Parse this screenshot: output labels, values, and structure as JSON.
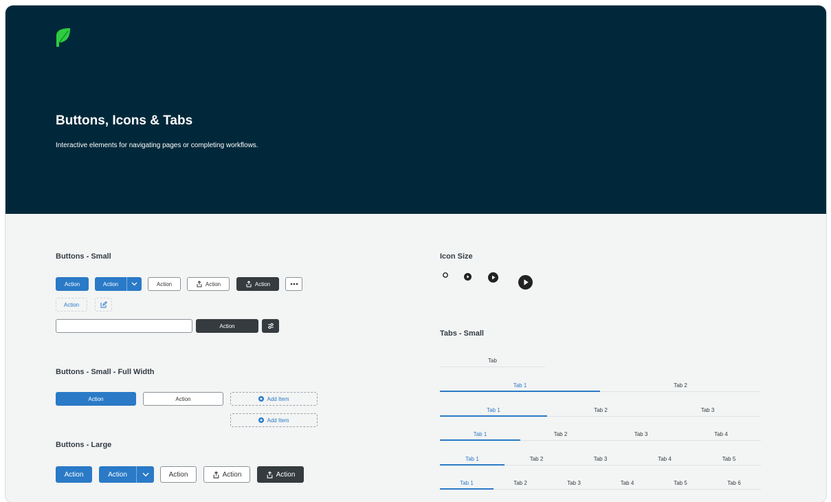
{
  "hero": {
    "title": "Buttons, Icons & Tabs",
    "subtitle": "Interactive elements for navigating pages or completing workflows."
  },
  "buttons_small": {
    "title": "Buttons - Small",
    "primary": "Action",
    "split": "Action",
    "outline": "Action",
    "outline_icon": "Action",
    "dark_icon": "Action",
    "ghost": "Action",
    "input_button": "Action"
  },
  "buttons_full": {
    "title": "Buttons - Small - Full Width",
    "primary": "Action",
    "outline": "Action",
    "add_item_1": "Add Item",
    "add_item_2": "Add Item"
  },
  "buttons_large": {
    "title": "Buttons - Large",
    "primary": "Action",
    "split": "Action",
    "outline": "Action",
    "outline_icon": "Action",
    "dark_icon": "Action"
  },
  "icon_size": {
    "title": "Icon Size"
  },
  "tabs_small": {
    "title": "Tabs - Small",
    "rows": [
      [
        "Tab"
      ],
      [
        "Tab 1",
        "Tab 2"
      ],
      [
        "Tab 1",
        "Tab 2",
        "Tab 3"
      ],
      [
        "Tab 1",
        "Tab 2",
        "Tab 3",
        "Tab 4"
      ],
      [
        "Tab 1",
        "Tab 2",
        "Tab 3",
        "Tab 4",
        "Tab 5"
      ],
      [
        "Tab 1",
        "Tab 2",
        "Tab 3",
        "Tab 4",
        "Tab 5",
        "Tab 6"
      ]
    ]
  },
  "colors": {
    "hero_bg": "#01283a",
    "primary": "#2a7ac7",
    "dark": "#353b3f",
    "logo": "#2ecc40"
  }
}
